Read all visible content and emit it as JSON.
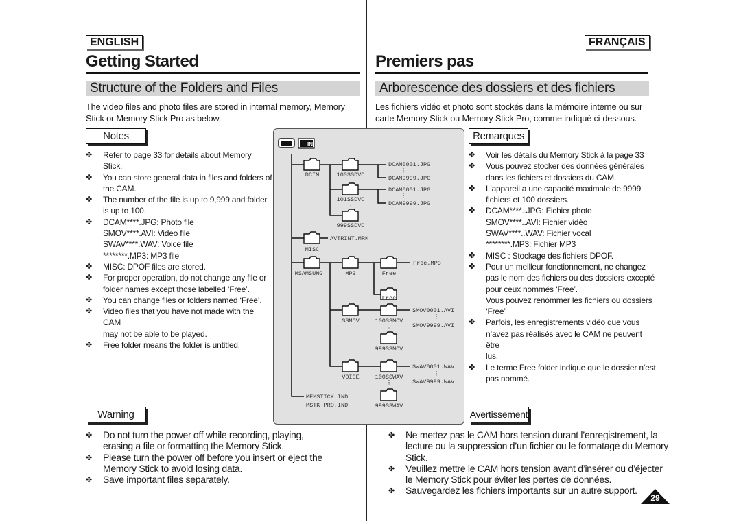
{
  "left": {
    "lang": "ENGLISH",
    "title": "Getting Started",
    "section": "Structure of the Folders and Files",
    "intro": [
      "The video files and photo files are stored in internal memory, Memory",
      "Stick or Memory Stick Pro as below."
    ],
    "notes_label": "Notes",
    "notes": [
      [
        "Refer to page 33 for details about Memory Stick."
      ],
      [
        "You can store general data in files and folders of",
        "the CAM."
      ],
      [
        "The number of the file is up to 9,999 and folder",
        "is up to 100."
      ],
      [
        "DCAM****.JPG: Photo file",
        "SMOV****.AVI: Video file",
        "SWAV****.WAV: Voice file",
        "********.MP3: MP3 file"
      ],
      [
        "MISC: DPOF files are stored."
      ],
      [
        "For proper operation, do not change any file or",
        "folder names except those labelled ‘Free’."
      ],
      [
        "You can change files or folders named ‘Free’."
      ],
      [
        "Video files that you have not made with the CAM",
        "may not be able to be played."
      ],
      [
        "Free folder means the folder is untitled."
      ]
    ],
    "warning_label": "Warning",
    "warnings": [
      [
        "Do not turn the power off while recording, playing,",
        "erasing a file or formatting the Memory Stick."
      ],
      [
        "Please turn the power off before you insert or eject the",
        "Memory Stick to avoid losing data."
      ],
      [
        "Save important files separately."
      ]
    ]
  },
  "right": {
    "lang": "FRANÇAIS",
    "title": "Premiers pas",
    "section": "Arborescence des dossiers et des fichiers",
    "intro": [
      "Les fichiers vidéo et photo sont stockés dans la mémoire interne ou sur",
      "carte Memory Stick ou Memory Stick Pro, comme indiqué ci-dessous."
    ],
    "notes_label": "Remarques",
    "notes": [
      [
        "Voir les détails du Memory Stick à la page 33"
      ],
      [
        "Vous pouvez stocker des données générales",
        "dans les fichiers et dossiers du CAM."
      ],
      [
        "L'appareil a une capacité maximale de 9999",
        "fichiers et 100 dossiers."
      ],
      [
        "DCAM****..JPG: Fichier photo",
        "SMOV****..AVI:  Fichier vidéo",
        "SWAV****..WAV:  Fichier vocal",
        "********.MP3:  Fichier MP3"
      ],
      [
        "MISC : Stockage des fichiers DPOF."
      ],
      [
        "Pour un meilleur fonctionnement, ne changez",
        "pas le nom des fichiers ou des dossiers excepté",
        "pour ceux nommés ‘Free’.",
        "Vous pouvez renommer les fichiers ou dossiers",
        "‘Free’"
      ],
      [
        "Parfois, les enregistrements vidéo que vous",
        "n’avez pas réalisés avec le CAM ne peuvent être",
        "lus."
      ],
      [
        "Le terme Free folder indique que le dossier n’est",
        "pas nommé."
      ]
    ],
    "warning_label": "Avertissement",
    "warnings": [
      [
        "Ne mettez pas le CAM hors tension durant l’enregistrement, la",
        "lecture ou la suppression d’un fichier ou le formatage du Memory",
        "Stick."
      ],
      [
        "Veuillez mettre le CAM hors tension avant d’insérer ou d’éjecter",
        "le Memory Stick pour éviter les pertes de données."
      ],
      [
        "Sauvegardez les fichiers importants sur un autre support."
      ]
    ]
  },
  "diagram": {
    "icons": [
      "memory-card-icon",
      "internal-memory-icon"
    ],
    "in_label": "IN",
    "dcim": "DCIM",
    "f100ssdvc": "100SSDVC",
    "f101ssdvc": "101SSDVC",
    "f999ssdvc": "999SSDVC",
    "dcam0001": "DCAM0001.JPG",
    "dcam9999": "DCAM9999.JPG",
    "misc": "MISC",
    "avtrint": "AVTRINT.MRK",
    "msamsung": "MSAMSUNG",
    "mp3": "MP3",
    "free": "Free",
    "free_mp3": "Free.MP3",
    "ssmov": "SSMOV",
    "f100ssmov": "100SSMOV",
    "f999ssmov": "999SSMOV",
    "smov0001": "SMOV0001.AVI",
    "smov9999": "SMOV9999.AVI",
    "voice": "VOICE",
    "f100sswav": "100SSWAV",
    "f999sswav": "999SSWAV",
    "swav0001": "SWAV0001.WAV",
    "swav9999": "SWAV9999.WAV",
    "memstick": "MEMSTICK.IND",
    "mstkpro": "MSTK_PRO.IND",
    "ellipsis": "⋮"
  },
  "bullet": "✤",
  "page_number": "29"
}
